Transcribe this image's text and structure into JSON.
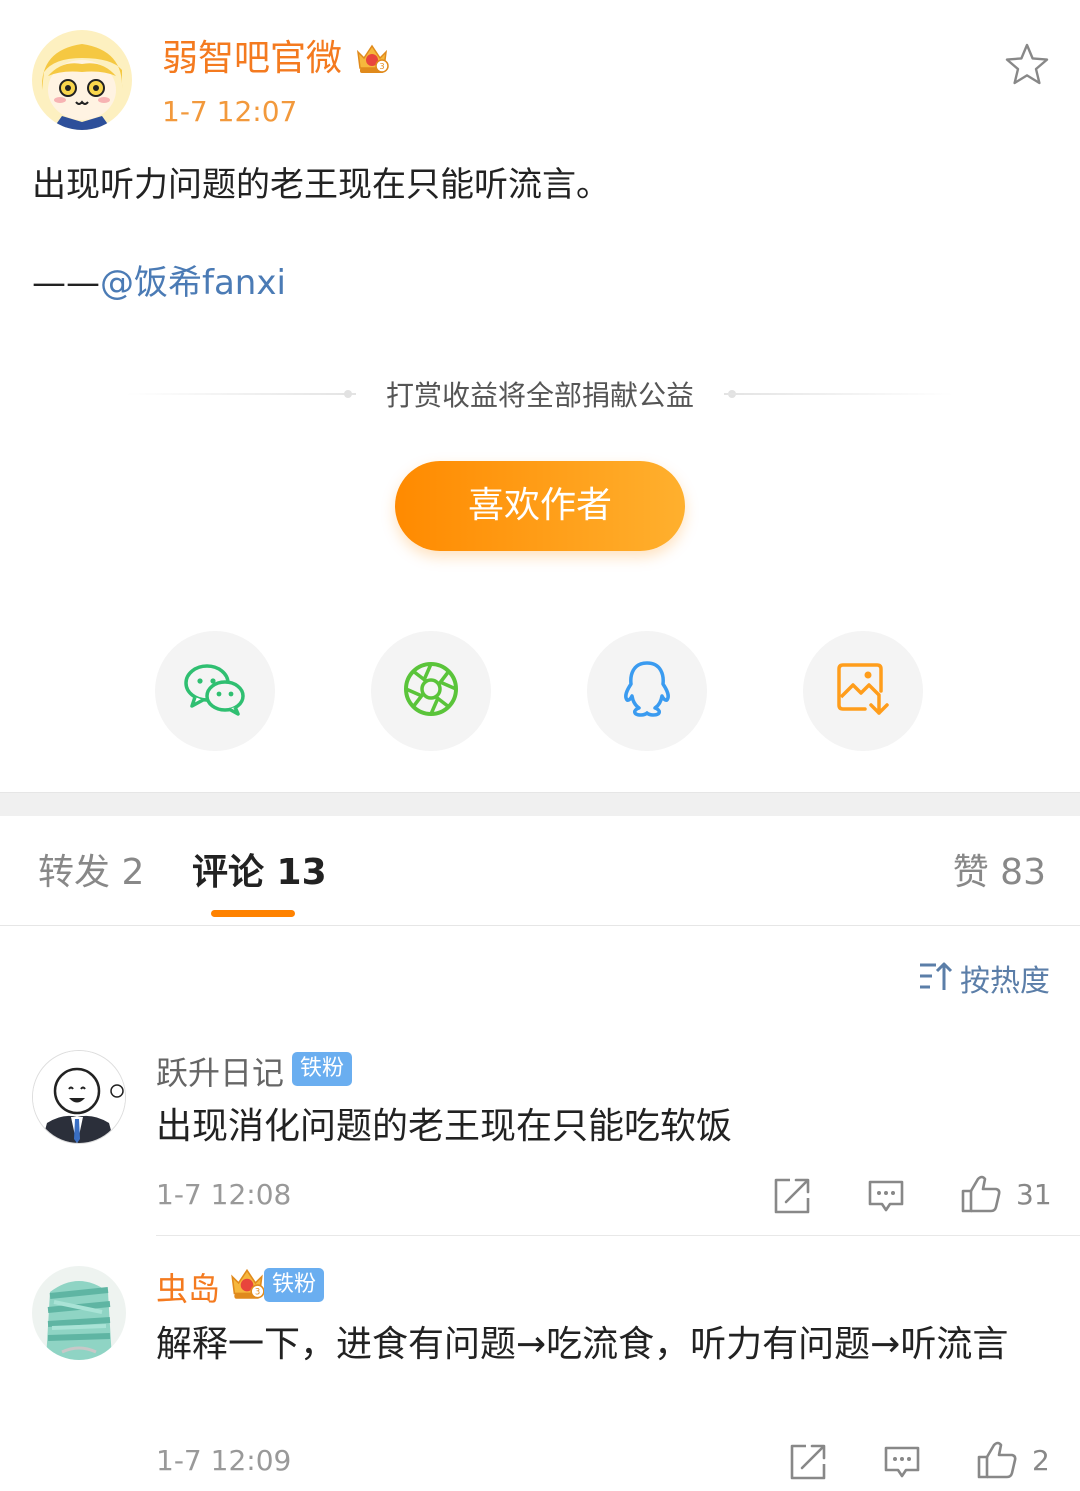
{
  "post": {
    "author_name": "弱智吧官微",
    "time": "1-7 12:07",
    "text": "出现听力问题的老王现在只能听流言。",
    "credit_dash": "——",
    "credit_mention": "@饭希fanxi",
    "reward_note": "打赏收益将全部捐献公益",
    "like_author_label": "喜欢作者",
    "share_targets": [
      {
        "icon": "wechat-icon",
        "color": "#2fbf71"
      },
      {
        "icon": "moments-icon",
        "color": "#5ac43a"
      },
      {
        "icon": "qq-icon",
        "color": "#3a9bf0"
      },
      {
        "icon": "save-image-icon",
        "color": "#ff9d1b"
      }
    ]
  },
  "tabs": {
    "repost": "转发 2",
    "comments": "评论 13",
    "likes": "赞 83"
  },
  "sort": {
    "label": "按热度"
  },
  "comments": [
    {
      "name": "跃升日记",
      "badge": "铁粉",
      "text": "出现消化问题的老王现在只能吃软饭",
      "time": "1-7 12:08",
      "likes": "31"
    },
    {
      "name": "虫岛",
      "badge": "铁粉",
      "text": "解释一下，进食有问题→吃流食，听力有问题→听流言",
      "time": "1-7 12:09",
      "likes": "2"
    }
  ],
  "colors": {
    "accent": "#ff8200",
    "author": "#f47a1f",
    "link": "#4b7bb5",
    "fan_badge": "#6aaef0"
  }
}
